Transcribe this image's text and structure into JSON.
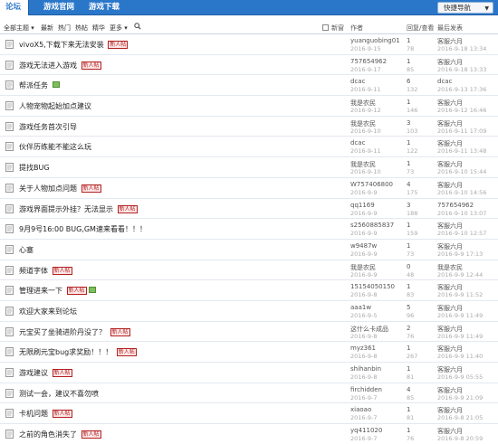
{
  "nav": {
    "tabs": [
      "论坛",
      "游戏官网",
      "游戏下载"
    ],
    "quick_nav": "快捷导航"
  },
  "filter": {
    "all": "全部主题",
    "latest": "最新",
    "hot": "热门",
    "heat": "热帖",
    "digest": "精华",
    "more": "更多",
    "new_window": "新窗",
    "author_header": "作者",
    "replies_header": "回复/查看",
    "last_header": "最后发表"
  },
  "badge_text": "新人帖",
  "threads": [
    {
      "title": "vivoX5,下载下来无法安装",
      "badge": true,
      "img": false,
      "author": "yuanguobing01",
      "date": "2016-9-15",
      "replies": "1",
      "views": "78",
      "last_user": "客服六月",
      "last_time": "2016-9-18 13:34"
    },
    {
      "title": "游戏无法进入游戏",
      "badge": true,
      "img": false,
      "author": "757654962",
      "date": "2016-9-17",
      "replies": "1",
      "views": "85",
      "last_user": "客服六月",
      "last_time": "2016-9-18 13:33"
    },
    {
      "title": "帮派任务",
      "badge": false,
      "img": true,
      "author": "dcac",
      "date": "2016-9-11",
      "replies": "6",
      "views": "132",
      "last_user": "dcac",
      "last_time": "2016-9-13 17:36"
    },
    {
      "title": "人物宠物起始加点建议",
      "badge": false,
      "img": false,
      "author": "我是农民",
      "date": "2016-9-12",
      "replies": "1",
      "views": "146",
      "last_user": "客服六月",
      "last_time": "2016-9-12 16:46"
    },
    {
      "title": "游戏任务首次引导",
      "badge": false,
      "img": false,
      "author": "我是农民",
      "date": "2016-9-10",
      "replies": "3",
      "views": "103",
      "last_user": "客服六月",
      "last_time": "2016-9-11 17:09"
    },
    {
      "title": "伙伴历练能不能这么玩",
      "badge": false,
      "img": false,
      "author": "dcac",
      "date": "2016-9-11",
      "replies": "1",
      "views": "122",
      "last_user": "客服六月",
      "last_time": "2016-9-11 13:48"
    },
    {
      "title": "提找BUG",
      "badge": false,
      "img": false,
      "author": "我是农民",
      "date": "2016-9-10",
      "replies": "1",
      "views": "73",
      "last_user": "客服六月",
      "last_time": "2016-9-10 15:44"
    },
    {
      "title": "关于人物加点问题",
      "badge": true,
      "img": false,
      "author": "W757406800",
      "date": "2016-9-9",
      "replies": "4",
      "views": "175",
      "last_user": "客服六月",
      "last_time": "2016-9-10 14:56"
    },
    {
      "title": "游戏界面提示外挂？无法显示",
      "badge": true,
      "img": false,
      "author": "qq1169",
      "date": "2016-9-9",
      "replies": "3",
      "views": "188",
      "last_user": "757654962",
      "last_time": "2016-9-10 13:07"
    },
    {
      "title": "9月9号16:00 BUG,GM速来看看！！！",
      "badge": false,
      "img": false,
      "author": "s2560885837",
      "date": "2016-9-9",
      "replies": "1",
      "views": "159",
      "last_user": "客服六月",
      "last_time": "2016-9-10 12:57"
    },
    {
      "title": "心塞",
      "badge": false,
      "img": false,
      "author": "w9487w",
      "date": "2016-9-9",
      "replies": "1",
      "views": "73",
      "last_user": "客服六月",
      "last_time": "2016-9-9 17:13"
    },
    {
      "title": "频道字体",
      "badge": true,
      "img": false,
      "author": "我是农民",
      "date": "2016-9-9",
      "replies": "0",
      "views": "48",
      "last_user": "我是农民",
      "last_time": "2016-9-9 12:44"
    },
    {
      "title": "管理进来一下",
      "badge": true,
      "img": true,
      "author": "15154050150",
      "date": "2016-9-8",
      "replies": "1",
      "views": "83",
      "last_user": "客服六月",
      "last_time": "2016-9-9 11:52"
    },
    {
      "title": "欢迎大家来到论坛",
      "badge": false,
      "img": false,
      "author": "aaa1w",
      "date": "2016-9-5",
      "replies": "5",
      "views": "96",
      "last_user": "客服六月",
      "last_time": "2016-9-9 11:49"
    },
    {
      "title": "元宝买了坐骑进阶丹没了？",
      "badge": true,
      "img": false,
      "author": "这什么卡成品",
      "date": "2016-9-8",
      "replies": "2",
      "views": "76",
      "last_user": "客服六月",
      "last_time": "2016-9-9 11:49"
    },
    {
      "title": "无限刷元宝bug求奖励！！！",
      "badge": true,
      "img": false,
      "author": "myz361",
      "date": "2016-9-8",
      "replies": "1",
      "views": "267",
      "last_user": "客服六月",
      "last_time": "2016-9-9 11:40"
    },
    {
      "title": "游戏建议",
      "badge": true,
      "img": false,
      "author": "shihanbin",
      "date": "2016-9-8",
      "replies": "1",
      "views": "81",
      "last_user": "客服六月",
      "last_time": "2016-9-9 05:55"
    },
    {
      "title": "测试一会，建议不喜勿喷",
      "badge": false,
      "img": false,
      "author": "firchidden",
      "date": "2016-9-7",
      "replies": "4",
      "views": "85",
      "last_user": "客服六月",
      "last_time": "2016-9-9 21:09"
    },
    {
      "title": "卡机问题",
      "badge": true,
      "img": false,
      "author": "xiaoao",
      "date": "2016-9-7",
      "replies": "1",
      "views": "81",
      "last_user": "客服六月",
      "last_time": "2016-9-8 21:05"
    },
    {
      "title": "之前的角色消失了",
      "badge": true,
      "img": false,
      "author": "yq411020",
      "date": "2016-9-7",
      "replies": "1",
      "views": "76",
      "last_user": "客服六月",
      "last_time": "2016-9-8 20:59"
    }
  ]
}
